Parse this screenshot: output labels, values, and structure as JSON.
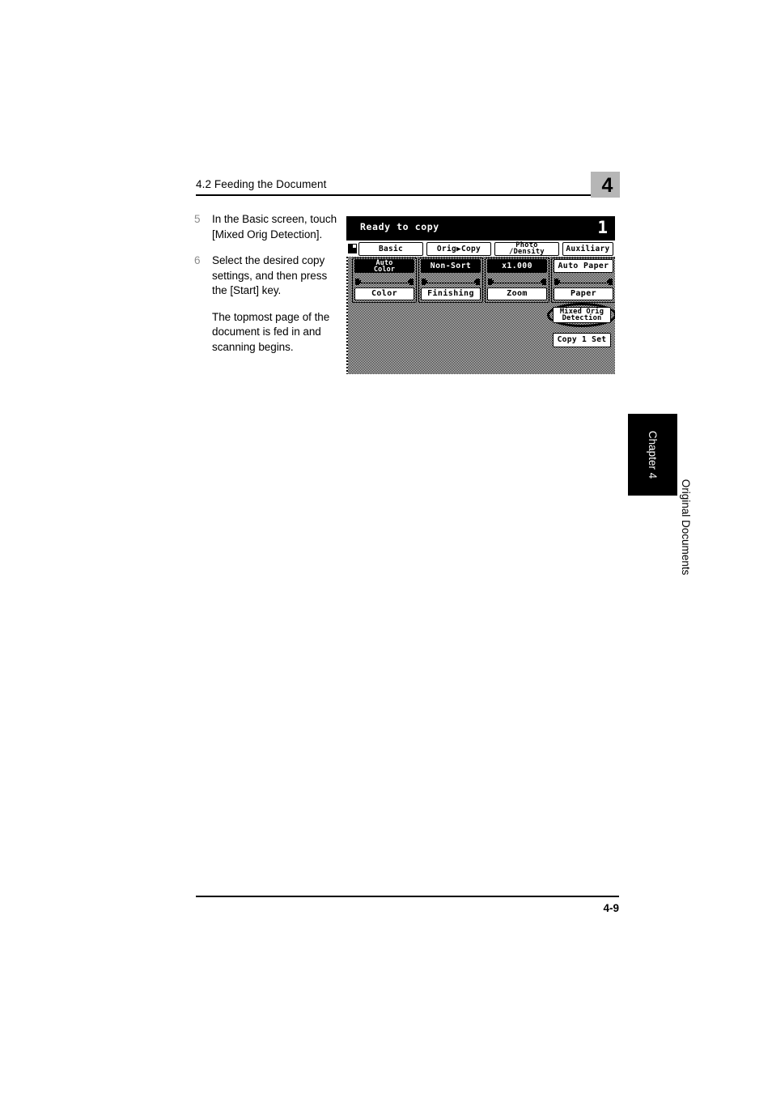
{
  "page": {
    "header_title": "4.2 Feeding the Document",
    "chapter_marker": "4",
    "footer_page": "4-9"
  },
  "side_tab": {
    "chapter_label": "Chapter 4",
    "section_label": "Original Documents"
  },
  "steps": [
    {
      "number": "5",
      "text": "In the Basic screen, touch [Mixed Orig Detection]."
    },
    {
      "number": "6",
      "text": "Select the desired copy settings, and then press the [Start] key.",
      "extra": "The topmost page of the document is fed in and scanning begins."
    }
  ],
  "lcd": {
    "status_text": "Ready to copy",
    "copy_count": "1",
    "doc_icon": "document-icon",
    "tabs": [
      {
        "label": "Basic",
        "active": true
      },
      {
        "label": "Orig▶Copy",
        "active": false
      },
      {
        "label_line1": "Photo",
        "label_line2": "/Density",
        "active": false
      },
      {
        "label": "Auxiliary",
        "active": false
      }
    ],
    "function_buttons": [
      {
        "value_line1": "Auto",
        "value_line2": "Color",
        "value_inverted": true,
        "label": "Color"
      },
      {
        "value": "Non-Sort",
        "value_inverted": true,
        "label": "Finishing"
      },
      {
        "value": "x1.000",
        "value_inverted": true,
        "label": "Zoom"
      },
      {
        "value": "Auto Paper",
        "value_inverted": false,
        "label": "Paper"
      }
    ],
    "soft_keys": {
      "mixed_orig_line1": "Mixed Orig",
      "mixed_orig_line2": "Detection",
      "copy_set": "Copy 1 Set"
    },
    "callout": {
      "shape": "oval",
      "target": "mixed-orig-detection-button"
    }
  },
  "colors": {
    "chapter_marker_bg": "#b6b6b6",
    "step_number": "#8c8c8c",
    "lcd_foreground": "#000000",
    "lcd_background": "#ffffff"
  }
}
